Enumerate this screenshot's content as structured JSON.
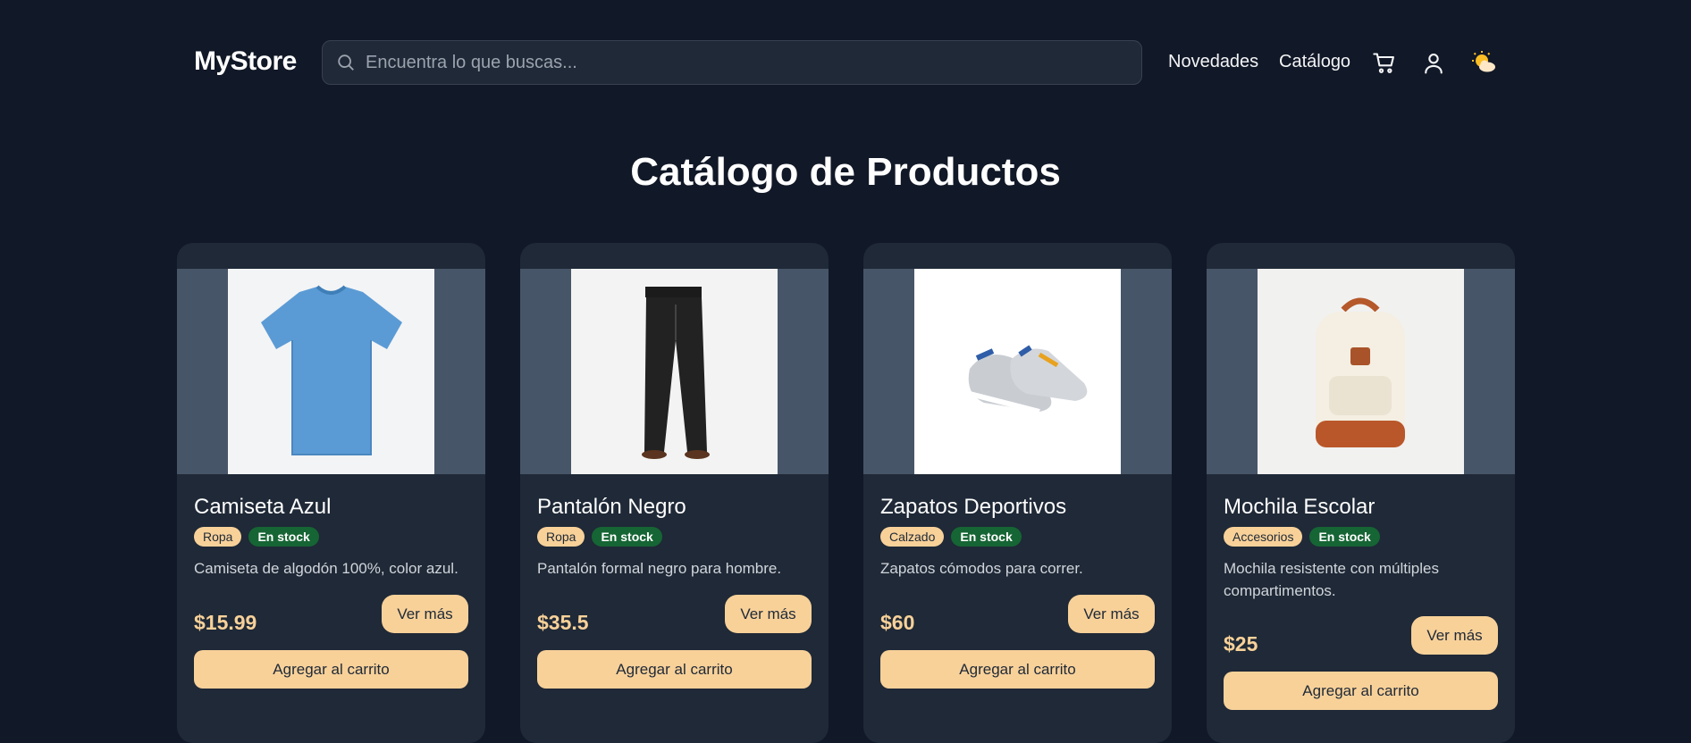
{
  "header": {
    "logo": "MyStore",
    "search_placeholder": "Encuentra lo que buscas...",
    "nav": [
      "Novedades",
      "Catálogo"
    ],
    "icons": [
      "cart-icon",
      "user-icon",
      "weather-icon"
    ]
  },
  "page": {
    "title": "Catálogo de Productos"
  },
  "products": [
    {
      "name": "Camiseta Azul",
      "category": "Ropa",
      "stock": "En stock",
      "description": "Camiseta de algodón 100%, color azul.",
      "price": "$15.99",
      "more_label": "Ver más",
      "cart_label": "Agregar al carrito",
      "image": "tshirt-image"
    },
    {
      "name": "Pantalón Negro",
      "category": "Ropa",
      "stock": "En stock",
      "description": "Pantalón formal negro para hombre.",
      "price": "$35.5",
      "more_label": "Ver más",
      "cart_label": "Agregar al carrito",
      "image": "pants-image"
    },
    {
      "name": "Zapatos Deportivos",
      "category": "Calzado",
      "stock": "En stock",
      "description": "Zapatos cómodos para correr.",
      "price": "$60",
      "more_label": "Ver más",
      "cart_label": "Agregar al carrito",
      "image": "sneakers-image"
    },
    {
      "name": "Mochila Escolar",
      "category": "Accesorios",
      "stock": "En stock",
      "description": "Mochila resistente con múltiples compartimentos.",
      "price": "$25",
      "more_label": "Ver más",
      "cart_label": "Agregar al carrito",
      "image": "backpack-image"
    }
  ],
  "colors": {
    "background": "#111827",
    "card": "#1f2937",
    "accent": "#f8d199",
    "stock": "#166534"
  }
}
